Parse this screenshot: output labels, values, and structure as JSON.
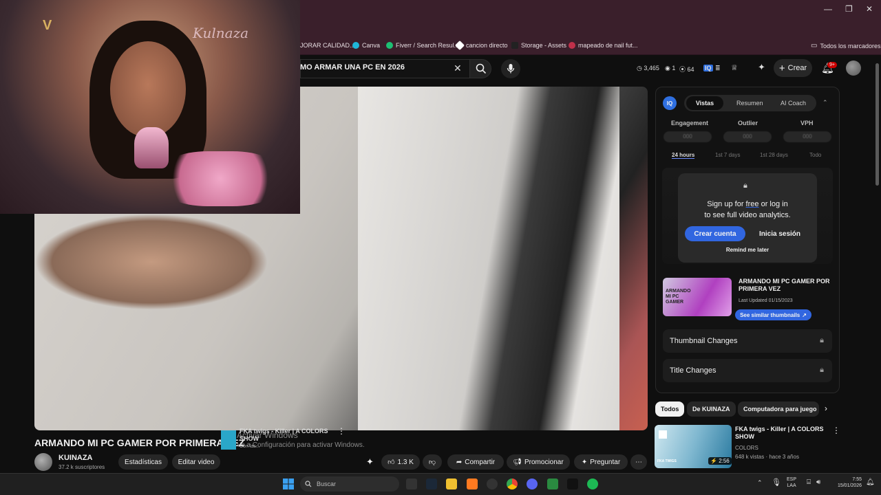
{
  "browser": {
    "bookmarks": [
      {
        "label": "JORAR CALIDAD...",
        "color": "#888888"
      },
      {
        "label": "Canva",
        "color": "#1fb6d9"
      },
      {
        "label": "Fiverr / Search Resul...",
        "color": "#1dbf73"
      },
      {
        "label": "cancion directo",
        "color": "#ffffff"
      },
      {
        "label": "Storage - Assets",
        "color": "#222222"
      },
      {
        "label": "mapeado de nail fut...",
        "color": "#c0304a"
      }
    ],
    "all_bookmarks": "Todos los marcadores"
  },
  "header": {
    "search_query": "MO ARMAR UNA PC EN 2026",
    "stats": {
      "views": "3,465",
      "eye": "1",
      "coins": "64"
    },
    "create_label": "Crear",
    "notifications_badge": "9+"
  },
  "webcam": {
    "overlay_name": "Kulnaza"
  },
  "video": {
    "title": "ARMANDO MI PC GAMER POR PRIMERA VEZ",
    "channel_name": "KUINAZA",
    "channel_subs": "37.2 k suscriptores",
    "actions": {
      "stats": "Estadísticas",
      "edit": "Editar video",
      "likes": "1.3 K",
      "share": "Compartir",
      "promote": "Promocionar",
      "ask": "Preguntar"
    },
    "overlay_card": {
      "title_frag": "SHOW",
      "title_frag2": "FKA twigs - Killer | A COLORS",
      "meta": "Con las..."
    }
  },
  "windows_watermark": {
    "title": "Activar Windows",
    "subtitle": "Ve a Configuración para activar Windows."
  },
  "panel": {
    "tabs": [
      "Vistas",
      "Resumen",
      "AI Coach"
    ],
    "metrics": [
      "Engagement",
      "Outlier",
      "VPH"
    ],
    "metric_values": [
      "000",
      "000",
      "000"
    ],
    "periods": [
      "24 hours",
      "1st 7 days",
      "1st 28 days",
      "Todo"
    ],
    "signup_text_1": "Sign up for",
    "signup_free": "free",
    "signup_text_2": "or log in",
    "signup_text_3": "to see full video analytics.",
    "btn_create": "Crear cuenta",
    "btn_login": "Inicia sesión",
    "remind": "Remind me later",
    "thumb_overlay": "ARMANDO MI PC GAMER",
    "video_title": "ARMANDO MI PC GAMER POR PRIMERA VEZ",
    "last_updated": "Last Updated 01/15/2023",
    "similar": "See similar thumbnails",
    "locked_rows": [
      "Thumbnail Changes",
      "Title Changes"
    ]
  },
  "chips": [
    "Todos",
    "De KUINAZA",
    "Computadora para juego"
  ],
  "recommendation": {
    "title": "FKA twigs - Killer | A COLORS SHOW",
    "channel": "COLORS",
    "meta": "648 k vistas · hace 3 años",
    "duration": "2:56",
    "thumb_label": "FKA TWIGS"
  },
  "taskbar": {
    "search": "Buscar",
    "lang_1": "ESP",
    "lang_2": "LAA",
    "time": "7:55",
    "date": "15/01/2026"
  }
}
